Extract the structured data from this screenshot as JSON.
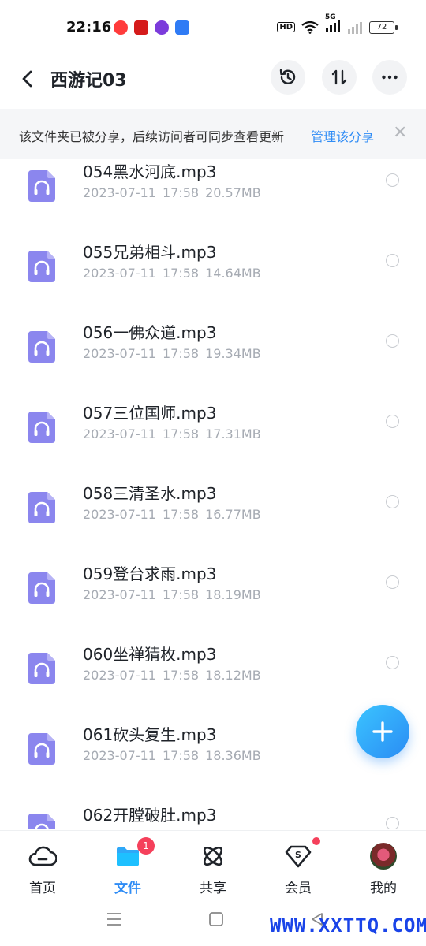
{
  "status_bar": {
    "time": "22:16",
    "hd": "HD",
    "network": "5G",
    "battery": "72"
  },
  "header": {
    "title": "西游记03",
    "back_icon": "chevron-left-icon",
    "actions": [
      "history-icon",
      "sort-icon",
      "more-icon"
    ]
  },
  "banner": {
    "text": "该文件夹已被分享，后续访问者可同步查看更新",
    "link": "管理该分享",
    "close": "✕"
  },
  "files": [
    {
      "name": "054黑水河底.mp3",
      "date": "2023-07-11",
      "time": "17:58",
      "size": "20.57MB"
    },
    {
      "name": "055兄弟相斗.mp3",
      "date": "2023-07-11",
      "time": "17:58",
      "size": "14.64MB"
    },
    {
      "name": "056一佛众道.mp3",
      "date": "2023-07-11",
      "time": "17:58",
      "size": "19.34MB"
    },
    {
      "name": "057三位国师.mp3",
      "date": "2023-07-11",
      "time": "17:58",
      "size": "17.31MB"
    },
    {
      "name": "058三清圣水.mp3",
      "date": "2023-07-11",
      "time": "17:58",
      "size": "16.77MB"
    },
    {
      "name": "059登台求雨.mp3",
      "date": "2023-07-11",
      "time": "17:58",
      "size": "18.19MB"
    },
    {
      "name": "060坐禅猜枚.mp3",
      "date": "2023-07-11",
      "time": "17:58",
      "size": "18.12MB"
    },
    {
      "name": "061砍头复生.mp3",
      "date": "2023-07-11",
      "time": "17:58",
      "size": "18.36MB"
    },
    {
      "name": "062开膛破肚.mp3",
      "date": "",
      "time": "",
      "size": ""
    }
  ],
  "fab": {
    "icon": "plus-icon"
  },
  "bottom_nav": {
    "items": [
      {
        "label": "首页",
        "icon": "cloud-home-icon"
      },
      {
        "label": "文件",
        "icon": "folder-icon"
      },
      {
        "label": "共享",
        "icon": "share-atom-icon"
      },
      {
        "label": "会员",
        "icon": "vip-diamond-icon"
      },
      {
        "label": "我的",
        "icon": "avatar-icon"
      }
    ],
    "active": "文件",
    "share_badge": "1"
  },
  "watermark": "WWW.XXTTQ.COM",
  "colors": {
    "accent": "#2f8cf5",
    "file_icon": "#8b86ee",
    "badge": "#f5405b"
  }
}
